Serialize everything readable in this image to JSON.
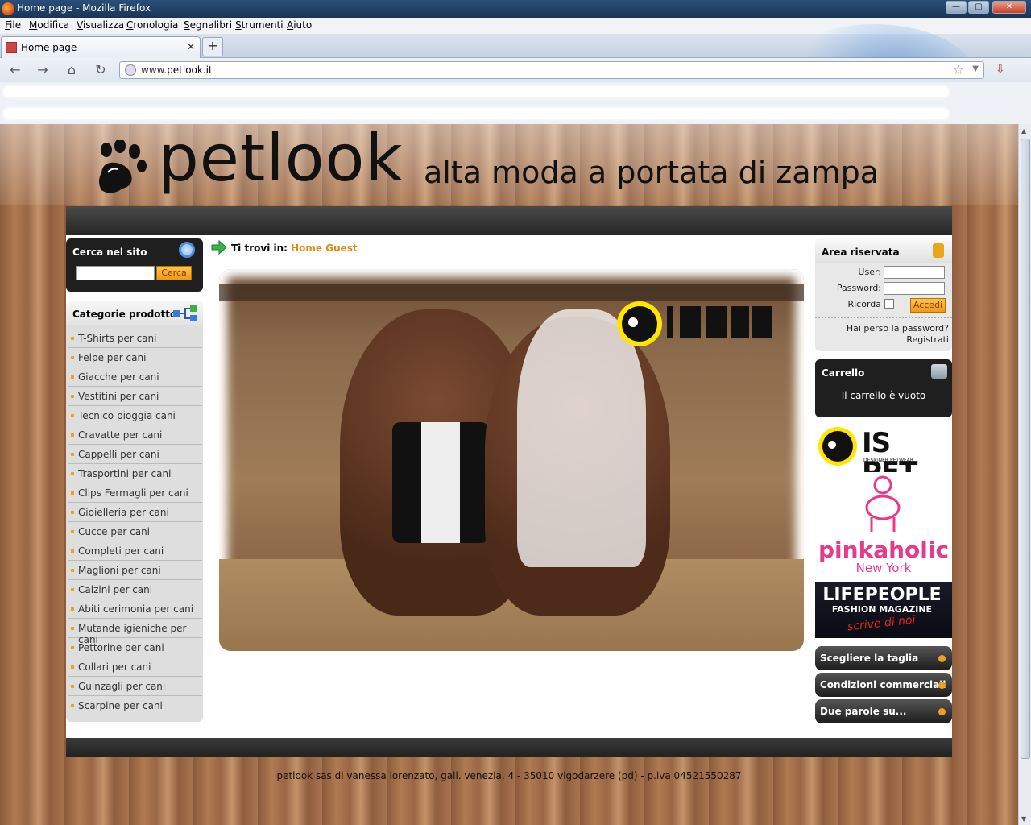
{
  "window": {
    "title": "Home page - Mozilla Firefox"
  },
  "menu": [
    "File",
    "Modifica",
    "Visualizza",
    "Cronologia",
    "Segnalibri",
    "Strumenti",
    "Aiuto"
  ],
  "tab": {
    "label": "Home page"
  },
  "address": {
    "prefix": "www.",
    "domain": "petlook.it"
  },
  "site": {
    "brand": "petlook",
    "slogan": "alta moda a portata di zampa",
    "search": {
      "title": "Cerca nel sito",
      "button": "Cerca"
    },
    "categories": {
      "title": "Categorie prodotto",
      "items": [
        "T-Shirts per cani",
        "Felpe per cani",
        "Giacche per cani",
        "Vestitini per cani",
        "Tecnico pioggia cani",
        "Cravatte per cani",
        "Cappelli per cani",
        "Trasportini per cani",
        "Clips Fermagli per cani",
        "Gioielleria per cani",
        "Cucce per cani",
        "Completi per cani",
        "Maglioni per cani",
        "Calzini per cani",
        "Abiti cerimonia per cani",
        "Mutande igieniche per cani",
        "Pettorine per cani",
        "Collari per cani",
        "Guinzagli per cani",
        "Scarpine per cani"
      ]
    },
    "breadcrumb": {
      "prefix": "Ti trovi in:",
      "link": "Home Guest"
    },
    "login": {
      "title": "Area riservata",
      "user_label": "User:",
      "password_label": "Password:",
      "remember_label": "Ricorda",
      "button": "Accedi",
      "lost_password": "Hai perso la password?",
      "register": "Registrati"
    },
    "cart": {
      "title": "Carrello",
      "empty": "Il carrello è vuoto"
    },
    "banners": {
      "ispet": {
        "name": "IS PET",
        "sub": "DESIGNER PETWEAR"
      },
      "pinkaholic": {
        "name": "pinkaholic",
        "sub": "New York"
      },
      "lifepeople": {
        "name": "LIFEPEOPLE",
        "sub": "FASHION MAGAZINE",
        "tag": "scrive di noi"
      }
    },
    "buttons": [
      "Scegliere la taglia",
      "Condizioni commerciali",
      "Due parole su..."
    ],
    "footer": "petlook sas di vanessa lorenzato, gall. venezia, 4 - 35010 vigodarzere (pd) - p.iva 04521550287",
    "colors": {
      "accent": "#e08a10",
      "dark": "#1f1f1f"
    }
  }
}
